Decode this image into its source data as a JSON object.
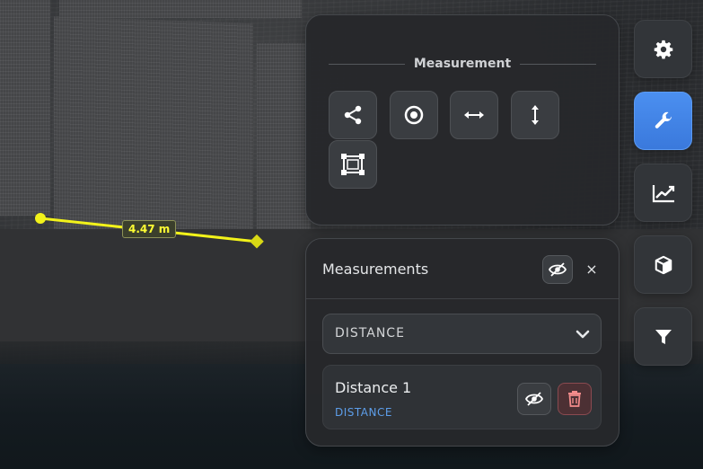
{
  "viewport": {
    "measurement_label": "4.47 m",
    "line_color": "#f2f21a"
  },
  "tools_panel": {
    "title": "Measurement",
    "tools": [
      {
        "icon": "share-nodes-icon"
      },
      {
        "icon": "point-target-icon"
      },
      {
        "icon": "horizontal-arrows-icon"
      },
      {
        "icon": "vertical-arrows-icon"
      },
      {
        "icon": "area-box-icon"
      }
    ]
  },
  "measurements_panel": {
    "title": "Measurements",
    "close_label": "×",
    "filter": {
      "selected": "DISTANCE"
    },
    "items": [
      {
        "name": "Distance 1",
        "type": "DISTANCE"
      }
    ]
  },
  "rail": {
    "buttons": [
      {
        "icon": "gear-icon",
        "active": false
      },
      {
        "icon": "wrench-icon",
        "active": true
      },
      {
        "icon": "line-chart-icon",
        "active": false
      },
      {
        "icon": "cube-icon",
        "active": false
      },
      {
        "icon": "filter-icon",
        "active": false
      }
    ],
    "accent": "#4589ee"
  }
}
